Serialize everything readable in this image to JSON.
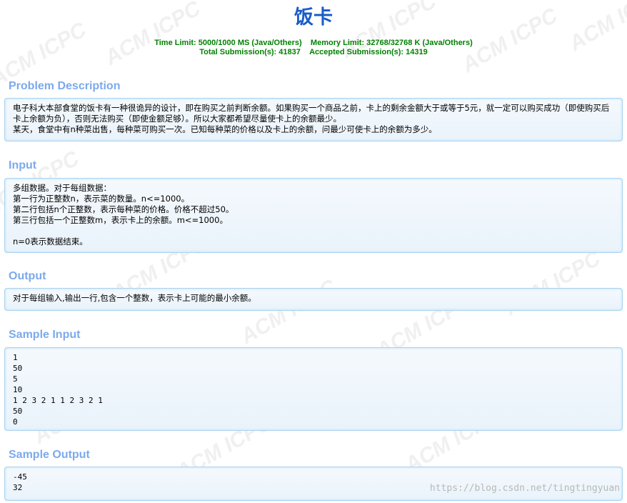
{
  "problem": {
    "title": "饭卡",
    "time_limit": "Time Limit: 5000/1000 MS (Java/Others)",
    "memory_limit": "Memory Limit: 32768/32768 K (Java/Others)",
    "total_submissions": "Total Submission(s): 41837",
    "accepted_submissions": "Accepted Submission(s): 14319"
  },
  "sections": {
    "description": {
      "heading": "Problem Description",
      "text": "电子科大本部食堂的饭卡有一种很诡异的设计，即在购买之前判断余额。如果购买一个商品之前，卡上的剩余金额大于或等于5元，就一定可以购买成功（即使购买后卡上余额为负），否则无法购买（即使金额足够）。所以大家都希望尽量使卡上的余额最少。\n某天，食堂中有n种菜出售，每种菜可购买一次。已知每种菜的价格以及卡上的余额，问最少可使卡上的余额为多少。"
    },
    "input": {
      "heading": "Input",
      "text": "多组数据。对于每组数据：\n第一行为正整数n，表示菜的数量。n<=1000。\n第二行包括n个正整数，表示每种菜的价格。价格不超过50。\n第三行包括一个正整数m，表示卡上的余额。m<=1000。\n\nn=0表示数据结束。"
    },
    "output": {
      "heading": "Output",
      "text": "对于每组输入,输出一行,包含一个整数，表示卡上可能的最小余额。"
    },
    "sample_input": {
      "heading": "Sample Input",
      "text": "1\n50\n5\n10\n1 2 3 2 1 1 2 3 2 1\n50\n0"
    },
    "sample_output": {
      "heading": "Sample Output",
      "text": "-45\n32"
    }
  },
  "watermark": {
    "logo_text": "ACM ICPC",
    "blog_url": "https://blog.csdn.net/tingtingyuan"
  }
}
